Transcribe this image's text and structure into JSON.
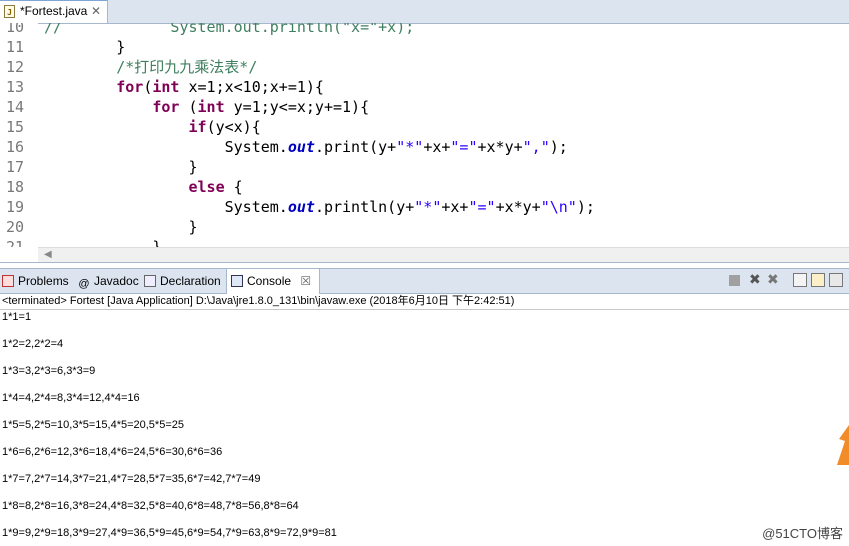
{
  "editor": {
    "tab_title": "*Fortest.java",
    "tab_close": "✕",
    "lines": [
      {
        "n": "10",
        "html": "<span class=\"cm\">//            System.out.println(\"x=\"+x);</span>"
      },
      {
        "n": "11",
        "html": "        }"
      },
      {
        "n": "12",
        "html": "        <span class=\"cm\">/*打印九九乘法表*/</span>"
      },
      {
        "n": "13",
        "html": "        <span class=\"kw\">for</span>(<span class=\"kw\">int</span> x=1;x&lt;10;x+=1){"
      },
      {
        "n": "14",
        "html": "            <span class=\"kw\">for</span> (<span class=\"kw\">int</span> y=1;y&lt;=x;y+=1){"
      },
      {
        "n": "15",
        "html": "                <span class=\"kw\">if</span>(y&lt;x){"
      },
      {
        "n": "16",
        "html": "                    System.<span class=\"fd\">out</span>.print(y+<span class=\"st\">\"*\"</span>+x+<span class=\"st\">\"=\"</span>+x*y+<span class=\"st\">\",\"</span>);"
      },
      {
        "n": "17",
        "html": "                }"
      },
      {
        "n": "18",
        "html": "                <span class=\"kw\">else</span> {"
      },
      {
        "n": "19",
        "html": "                    System.<span class=\"fd\">out</span>.println(y+<span class=\"st\">\"*\"</span>+x+<span class=\"st\">\"=\"</span>+x*y+<span class=\"st\">\"\\n\"</span>);"
      },
      {
        "n": "20",
        "html": "                }"
      },
      {
        "n": "21",
        "html": "            }"
      }
    ]
  },
  "views": {
    "tabs": [
      {
        "name": "problems",
        "label": "Problems"
      },
      {
        "name": "javadoc",
        "label": "Javadoc"
      },
      {
        "name": "declaration",
        "label": "Declaration"
      },
      {
        "name": "console",
        "label": "Console"
      }
    ],
    "console_close": "☒"
  },
  "status_text": "<terminated> Fortest [Java Application] D:\\Java\\jre1.8.0_131\\bin\\javaw.exe (2018年6月10日 下午2:42:51)",
  "output_lines": [
    "1*1=1",
    "1*2=2,2*2=4",
    "1*3=3,2*3=6,3*3=9",
    "1*4=4,2*4=8,3*4=12,4*4=16",
    "1*5=5,2*5=10,3*5=15,4*5=20,5*5=25",
    "1*6=6,2*6=12,3*6=18,4*6=24,5*6=30,6*6=36",
    "1*7=7,2*7=14,3*7=21,4*7=28,5*7=35,6*7=42,7*7=49",
    "1*8=8,2*8=16,3*8=24,4*8=32,5*8=40,6*8=48,7*8=56,8*8=64",
    "1*9=9,2*9=18,3*9=27,4*9=36,5*9=45,6*9=54,7*9=63,8*9=72,9*9=81"
  ],
  "watermark": "@51CTO博客",
  "colors": {
    "accent": "#7f0055",
    "string": "#2a00ff",
    "comment": "#3f7f5f"
  }
}
